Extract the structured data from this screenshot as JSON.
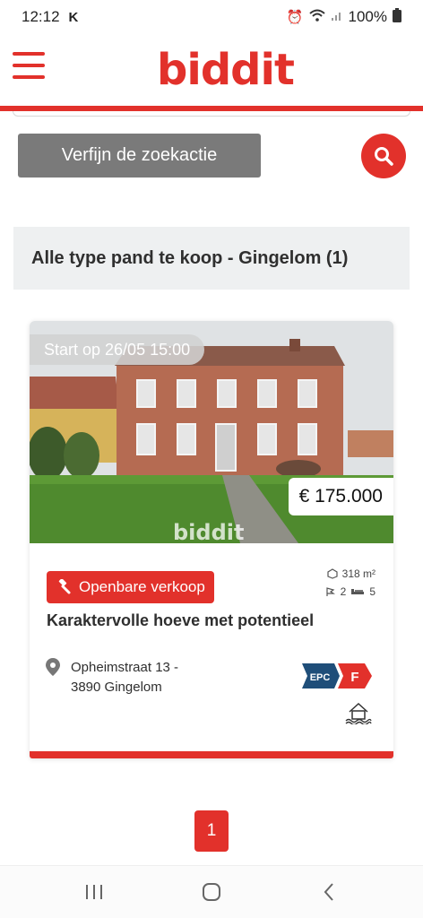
{
  "status_bar": {
    "time": "12:12",
    "carrier_glyph": "K",
    "battery": "100%",
    "icons": [
      "alarm-icon",
      "wifi-icon",
      "signal-icon",
      "battery-icon"
    ]
  },
  "header": {
    "logo": "biddit",
    "menu_icon": "hamburger-menu-icon"
  },
  "search": {
    "refine_label": "Verfijn de zoekactie",
    "search_icon": "search-icon"
  },
  "results": {
    "heading": "Alle type pand te koop - Gingelom (1)"
  },
  "listing": {
    "start_label": "Start op 26/05 15:00",
    "price": "€ 175.000",
    "watermark": "biddit",
    "sale_type": "Openbare verkoop",
    "area": "318 m²",
    "rooms": "2",
    "bedrooms": "5",
    "title": "Karaktervolle hoeve met potentieel",
    "address_line1": "Opheimstraat 13 -",
    "address_line2": "3890 Gingelom",
    "epc_label": "EPC",
    "epc_grade": "F",
    "colors": {
      "epc_dark": "#1f4e79",
      "epc_grade": "#e2312b"
    }
  },
  "pagination": {
    "current_page": "1"
  },
  "colors": {
    "brand": "#e2312b",
    "button_grey": "#7a7a7a",
    "header_bg": "#eef0f1"
  },
  "android_nav": [
    "recent-apps-icon",
    "home-icon",
    "back-icon"
  ]
}
